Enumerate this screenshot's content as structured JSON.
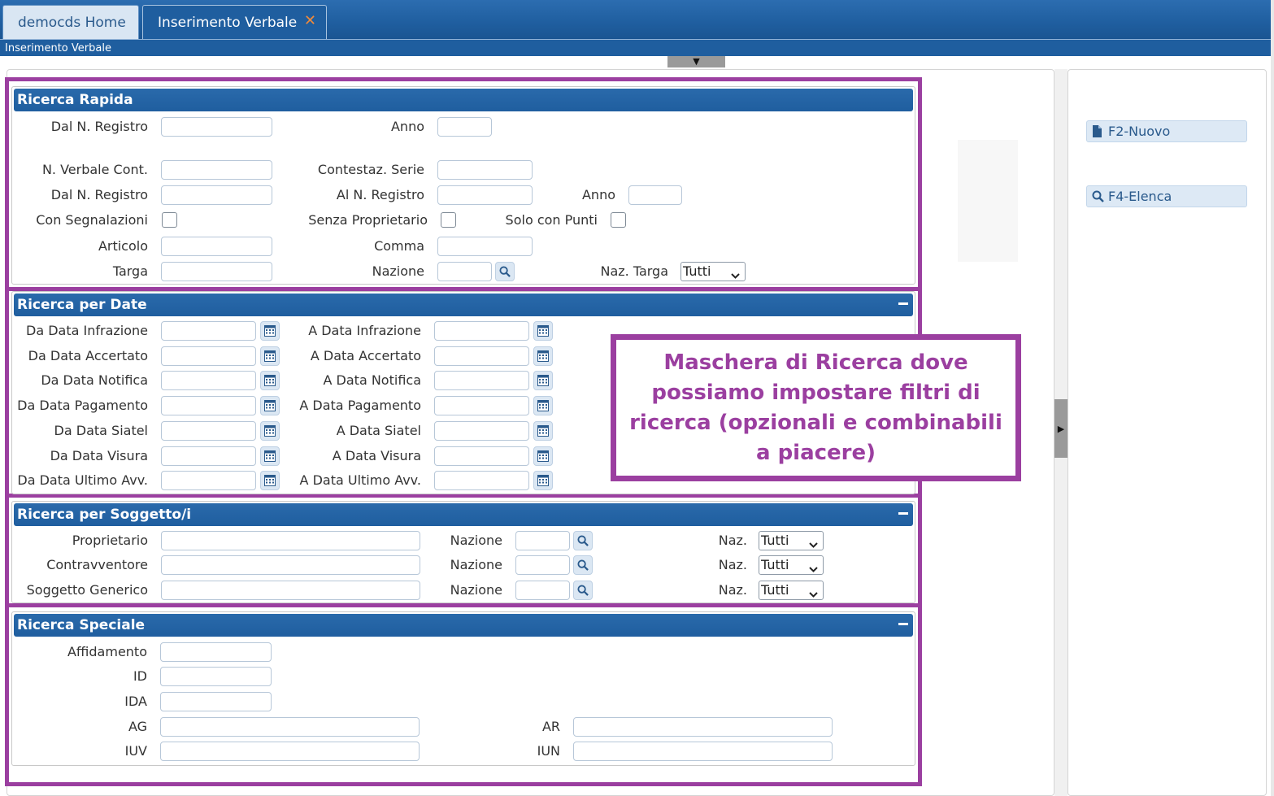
{
  "colors": {
    "accent": "#1f5e9f",
    "highlight": "#9b3fa0",
    "close": "#f08a3a"
  },
  "tabs": [
    {
      "label": "democds Home"
    },
    {
      "label": "Inserimento Verbale"
    }
  ],
  "breadcrumb": "Inserimento Verbale",
  "side_buttons": {
    "nuovo": "F2-Nuovo",
    "elenca": "F4-Elenca"
  },
  "sections": {
    "rapida": {
      "title": "Ricerca Rapida",
      "dal_registro_1": "Dal N. Registro",
      "anno_1": "Anno",
      "verbale_cont": "N. Verbale Cont.",
      "contestaz_serie": "Contestaz. Serie",
      "dal_registro_2": "Dal N. Registro",
      "al_registro": "Al N. Registro",
      "anno_2": "Anno",
      "con_segnalazioni": "Con Segnalazioni",
      "senza_proprietario": "Senza Proprietario",
      "solo_punti": "Solo con Punti",
      "articolo": "Articolo",
      "comma": "Comma",
      "targa": "Targa",
      "nazione": "Nazione",
      "naz_targa": "Naz. Targa",
      "naz_targa_value": "Tutti"
    },
    "date": {
      "title": "Ricerca per Date",
      "rows": [
        {
          "from": "Da Data Infrazione",
          "to": "A Data Infrazione"
        },
        {
          "from": "Da Data Accertato",
          "to": "A Data Accertato"
        },
        {
          "from": "Da Data Notifica",
          "to": "A Data Notifica"
        },
        {
          "from": "Da Data Pagamento",
          "to": "A Data Pagamento"
        },
        {
          "from": "Da Data Siatel",
          "to": "A Data Siatel"
        },
        {
          "from": "Da Data Visura",
          "to": "A Data Visura"
        },
        {
          "from": "Da Data Ultimo Avv.",
          "to": "A Data Ultimo Avv."
        }
      ]
    },
    "soggetti": {
      "title": "Ricerca per Soggetto/i",
      "rows": [
        {
          "label": "Proprietario",
          "nazione": "Nazione",
          "naz": "Naz.",
          "naz_value": "Tutti"
        },
        {
          "label": "Contravventore",
          "nazione": "Nazione",
          "naz": "Naz.",
          "naz_value": "Tutti"
        },
        {
          "label": "Soggetto Generico",
          "nazione": "Nazione",
          "naz": "Naz.",
          "naz_value": "Tutti"
        }
      ]
    },
    "speciale": {
      "title": "Ricerca Speciale",
      "affidamento": "Affidamento",
      "id": "ID",
      "ida": "IDA",
      "ag": "AG",
      "ar": "AR",
      "iuv": "IUV",
      "iun": "IUN"
    }
  },
  "callout": "Maschera di Ricerca dove possiamo impostare filtri di ricerca (opzionali e combinabili a piacere)"
}
